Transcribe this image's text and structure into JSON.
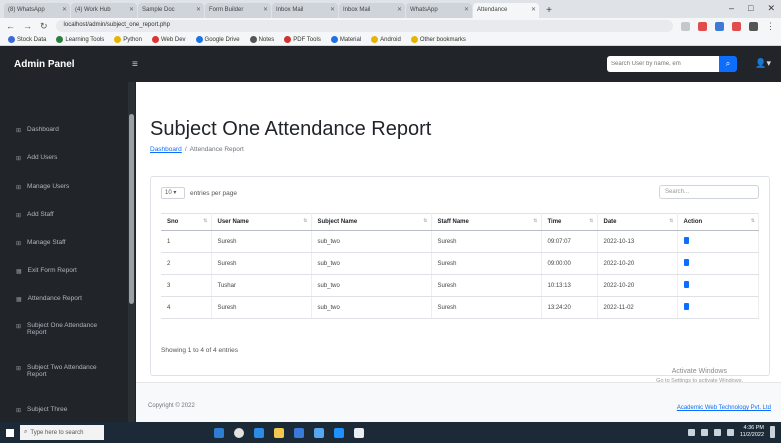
{
  "browser": {
    "tabs": [
      "(8) WhatsApp",
      "(4) Work Hub",
      "Sample Doc",
      "Form Builder",
      "Inbox Mail",
      "Inbox Mail",
      "WhatsApp",
      "Attendance"
    ],
    "url": "localhost/admin/subject_one_report.php",
    "bookmarks": [
      "Stock Data",
      "Learning Tools",
      "Python",
      "Web Dev",
      "Google Drive",
      "Notes",
      "PDF Tools",
      "Material",
      "Android",
      "Other bookmarks"
    ]
  },
  "navbar": {
    "brand": "Admin Panel",
    "toggle_icon": "bars-icon",
    "search_placeholder": "Search User by name, em",
    "user_icon": "user-icon"
  },
  "sidebar": {
    "items": [
      {
        "label": "Dashboard"
      },
      {
        "label": "Add Users"
      },
      {
        "label": "Manage Users"
      },
      {
        "label": "Add Staff"
      },
      {
        "label": "Manage Staff"
      },
      {
        "label": "Exit Form Report"
      },
      {
        "label": "Attendance Report"
      },
      {
        "label": "Subject One Attendance Report"
      },
      {
        "label": "Subject Two Attendance Report"
      },
      {
        "label": "Subject Three"
      }
    ]
  },
  "main": {
    "title": "Subject One Attendance Report",
    "breadcrumb": {
      "link": "Dashboard",
      "sep": "/",
      "current": "Attendance Report"
    },
    "table_controls": {
      "length_value": "10",
      "length_label": "entries per page",
      "search_placeholder": "Search..."
    },
    "columns": [
      "Sno",
      "User Name",
      "Subject Name",
      "Staff Name",
      "Time",
      "Date",
      "Action"
    ],
    "rows": [
      [
        "1",
        "Suresh",
        "sub_two",
        "Suresh",
        "09:07:07",
        "2022-10-13"
      ],
      [
        "2",
        "Suresh",
        "sub_two",
        "Suresh",
        "09:00:00",
        "2022-10-20"
      ],
      [
        "3",
        "Tushar",
        "sub_two",
        "Suresh",
        "10:13:13",
        "2022-10-20"
      ],
      [
        "4",
        "Suresh",
        "sub_two",
        "Suresh",
        "13:24:20",
        "2022-11-02"
      ]
    ],
    "info": "Showing 1 to 4 of 4 entries"
  },
  "footer": {
    "copyright": "Copyright © 2022",
    "link": "Academic Web Technology Pvt. Ltd",
    "activate": "Activate Windows",
    "activate_sub": "Go to Settings to activate Windows."
  },
  "taskbar": {
    "search_placeholder": "Type here to search",
    "time": "4:36 PM",
    "date": "11/2/2022"
  }
}
